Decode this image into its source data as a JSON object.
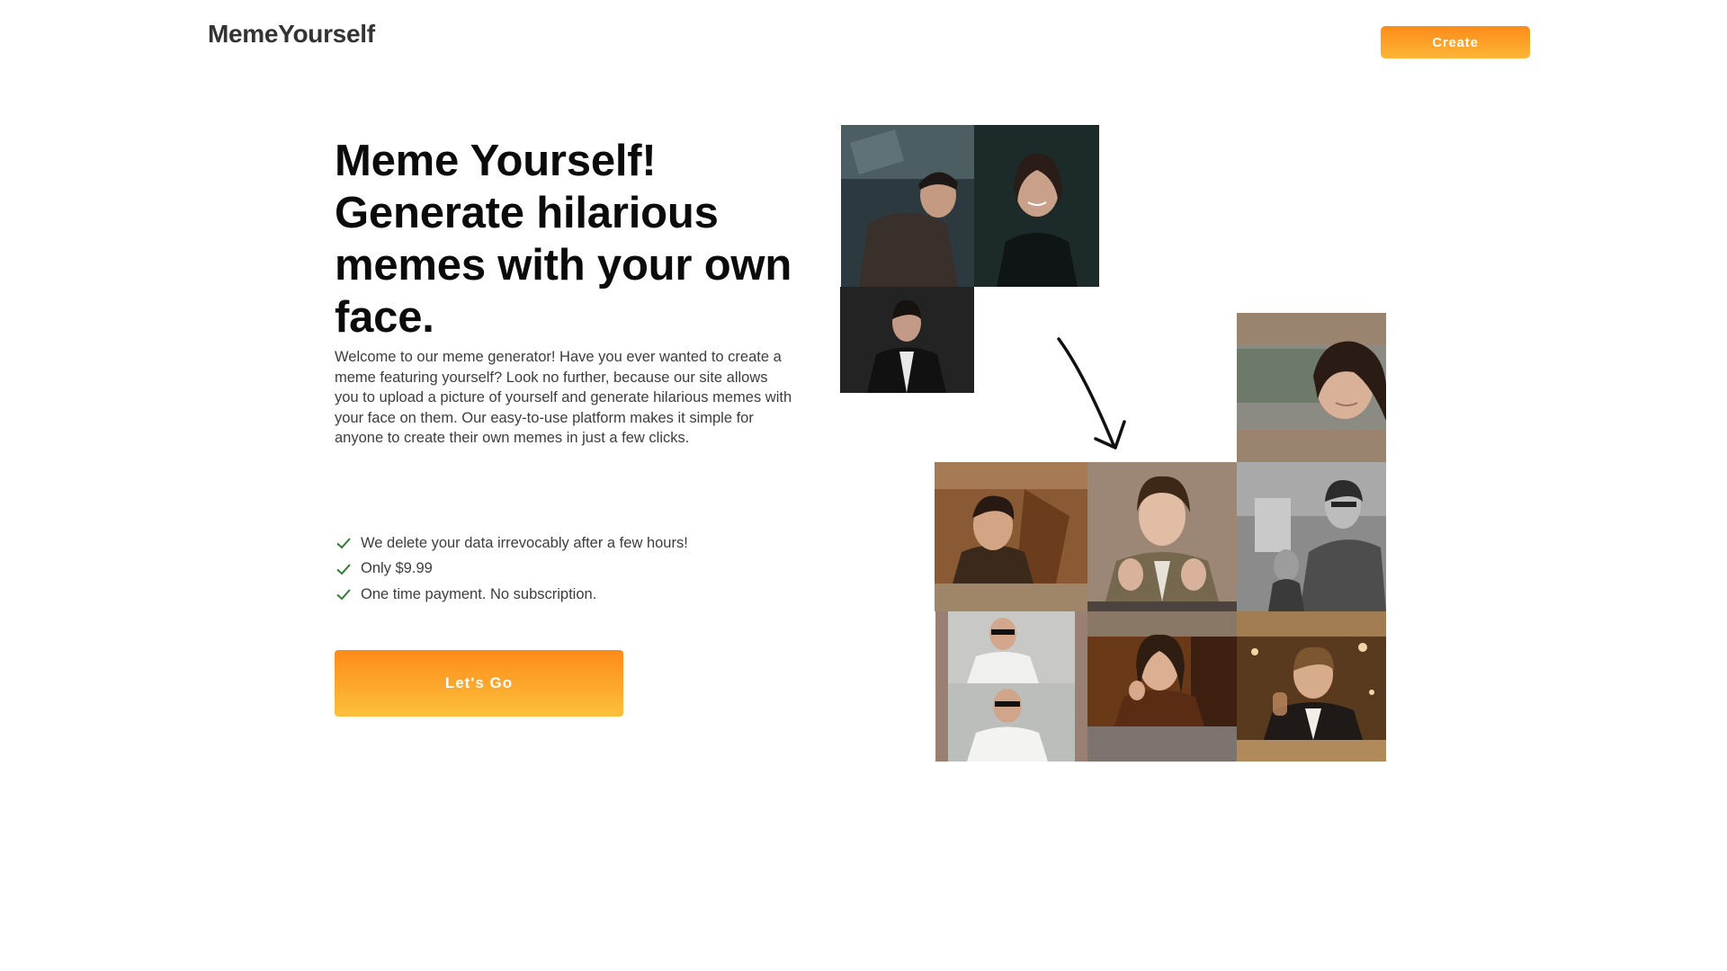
{
  "header": {
    "logo": "MemeYourself",
    "create_label": "Create"
  },
  "hero": {
    "headline_lines": [
      "Meme Yourself!",
      "Generate hilarious",
      "memes with your own",
      "face."
    ],
    "intro": "Welcome to our meme generator! Have you ever wanted to create a meme featuring yourself? Look no further, because our site allows you to upload a picture of yourself and generate hilarious memes with your face on them. Our easy-to-use platform makes it simple for anyone to create their own memes in just a few clicks.",
    "features": [
      "We delete your data irrevocably after a few hours!",
      "Only $9.99",
      "One time payment. No subscription."
    ],
    "cta_label": "Let's Go"
  },
  "icons": {
    "check": "check-icon",
    "arrow": "arrow-down-right-icon"
  },
  "colors": {
    "accent_top": "#fd8b1a",
    "accent_bottom": "#fcb637",
    "check": "#2e7d32"
  }
}
